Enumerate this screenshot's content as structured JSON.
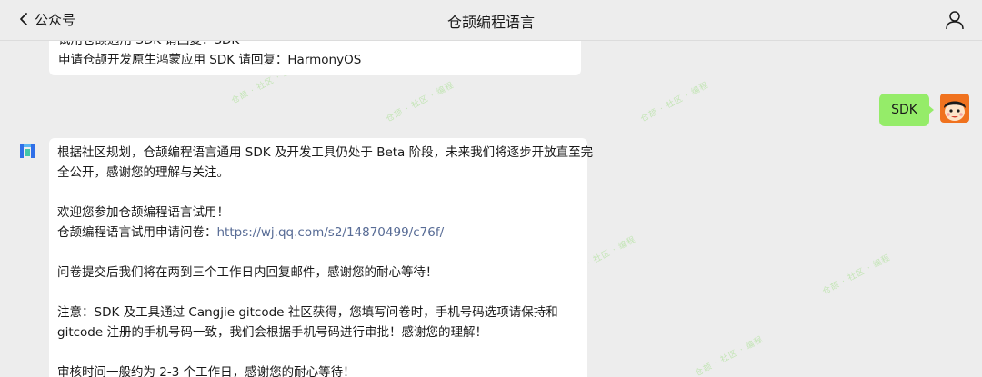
{
  "header": {
    "back_label": "公众号",
    "title": "仓颉编程语言",
    "back_icon": "chevron-left-icon",
    "profile_icon": "person-icon"
  },
  "messages": {
    "previous_lines": [
      "试用仓颉通用 SDK 请回复：SDK",
      "申请仓颉开发原生鸿蒙应用 SDK 请回复：HarmonyOS"
    ],
    "user_reply": "SDK",
    "bot_reply": {
      "line1": "根据社区规划，仓颉编程语言通用 SDK 及开发工具仍处于 Beta 阶段，未来我们将逐步开放直至完",
      "line2": "全公开，感谢您的理解与关注。",
      "welcome": "欢迎您参加仓颉编程语言试用！",
      "apply_prefix": "仓颉编程语言试用申请问卷：",
      "apply_link": "https://wj.qq.com/s2/14870499/c76f/",
      "reply_notice": "问卷提交后我们将在两到三个工作日内回复邮件，感谢您的耐心等待！",
      "note_line1": "注意：SDK 及工具通过 Cangjie gitcode 社区获得，您填写问卷时，手机号码选项请保持和",
      "note_line2": "gitcode 注册的手机号码一致，我们会根据手机号码进行审批！感谢您的理解！",
      "review_time": "审核时间一般约为 2-3 个工作日，感谢您的耐心等待！"
    }
  },
  "colors": {
    "background": "#ededed",
    "bubble_incoming": "#ffffff",
    "bubble_outgoing": "#95ec69",
    "link": "#576b95"
  }
}
